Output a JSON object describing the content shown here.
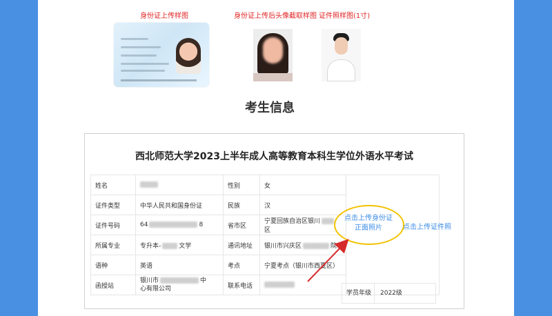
{
  "samples": {
    "id_label": "身份证上传样图",
    "crop_label": "身份证上传后头像截取样图",
    "photo_label": "证件照样图(1寸)"
  },
  "section_title": "考生信息",
  "exam": {
    "title": "西北师范大学2023上半年成人高等教育本科生学位外语水平考试"
  },
  "info": {
    "name_label": "姓名",
    "gender_label": "性别",
    "gender_value": "女",
    "id_type_label": "证件类型",
    "id_type_value": "中华人民共和国身份证",
    "ethnicity_label": "民族",
    "ethnicity_value": "汉",
    "id_number_label": "证件号码",
    "id_number_prefix": "64",
    "id_number_suffix": "8",
    "province_label": "省市区",
    "province_value": "宁夏回族自治区银川",
    "province_suffix": "区",
    "major_label": "所属专业",
    "major_prefix": "专升本-",
    "major_suffix": "文学",
    "address_label": "通讯地址",
    "address_prefix": "银川市兴庆区",
    "address_suffix": "院",
    "language_label": "语种",
    "language_value": "英语",
    "site_label": "考点",
    "site_value": "宁夏考点（银川市西夏区）",
    "station_label": "函授站",
    "station_prefix": "银川市",
    "station_mid": "中",
    "station_line2": "心有限公司",
    "phone_label": "联系电话",
    "grade_label": "学员年级",
    "grade_value": "2022级"
  },
  "actions": {
    "upload_id_line1": "点击上传身份证",
    "upload_id_line2": "正面照片",
    "upload_cert": "点击上传证件照"
  },
  "colors": {
    "accent_blue": "#3d8ee6",
    "highlight_yellow": "#f2c200",
    "sample_red": "#e02424",
    "arrow_red": "#d62b2b",
    "frame_blue": "#4a90e2"
  }
}
